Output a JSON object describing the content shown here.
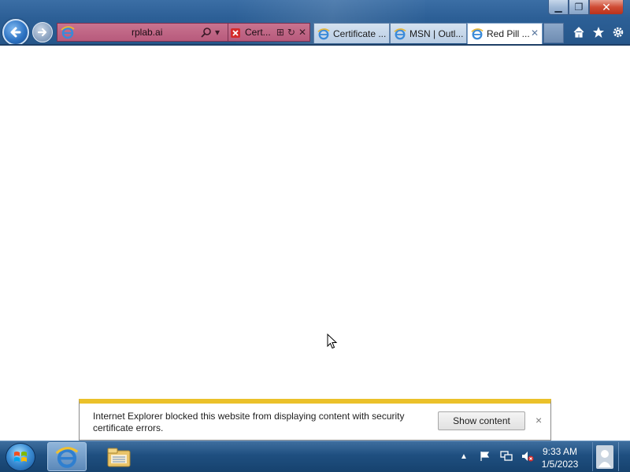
{
  "window": {
    "min_label": "▁",
    "restore_label": "❐",
    "close_label": "✕"
  },
  "address_bar": {
    "url": "rplab.ai",
    "cert_tab_label": "Cert..."
  },
  "tabs": [
    {
      "label": "Certificate ...",
      "icon": "ie-icon",
      "active": false
    },
    {
      "label": "MSN | Outl...",
      "icon": "ie-icon",
      "active": false
    },
    {
      "label": "Red Pill ...",
      "icon": "ie-icon",
      "active": true,
      "close": "✕"
    }
  ],
  "notification": {
    "message": "Internet Explorer blocked this website from displaying content with security certificate errors.",
    "button_label": "Show content",
    "close_label": "×",
    "accent_color": "#ebc12a"
  },
  "taskbar": {
    "time": "9:33 AM",
    "date": "1/5/2023",
    "tray_expand": "▲"
  },
  "colors": {
    "chrome": "#2c5f96",
    "address_error": "#b75a7c",
    "taskbar": "#1f4f80"
  }
}
